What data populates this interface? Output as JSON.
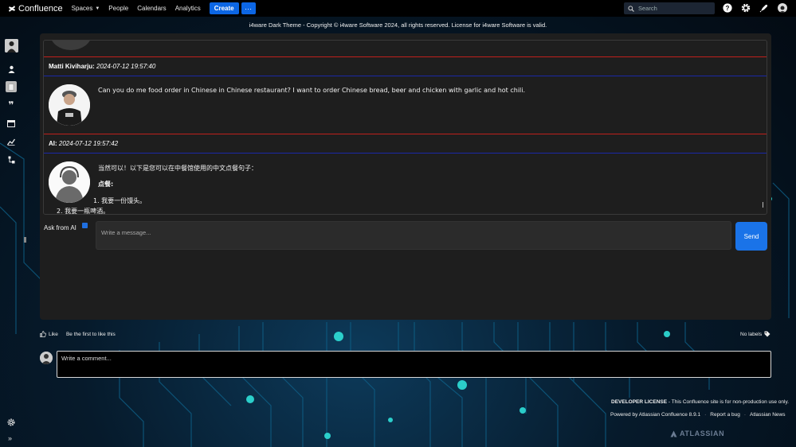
{
  "topbar": {
    "logo": "Confluence",
    "nav": [
      "Spaces",
      "People",
      "Calendars",
      "Analytics"
    ],
    "create_label": "Create",
    "more_label": "···",
    "search_placeholder": "Search"
  },
  "banner": "i4ware Dark Theme - Copyright © i4ware Software 2024, all rights reserved. License for i4ware Software is valid.",
  "chat": {
    "messages": [
      {
        "author": "Matti Kiviharju:",
        "timestamp": "2024-07-12 19:57:40",
        "text": "Can you do me food order in Chinese in Chinese restaurant? I want to order Chinese bread, beer and chicken with garlic and hot chili."
      },
      {
        "author": "AI:",
        "timestamp": "2024-07-12 19:57:42",
        "text": "当然可以！以下是您可以在中餐馆使用的中文点餐句子：",
        "heading": "点餐:",
        "items": [
          "1. 我要一份馒头。",
          "2. 我要一瓶啤酒。"
        ]
      }
    ]
  },
  "ask_ai_label": "Ask from AI",
  "message_placeholder": "Write a message...",
  "send_label": "Send",
  "like": {
    "label": "Like",
    "prompt": "Be the first to like this"
  },
  "labels_text": "No labels",
  "comment_placeholder": "Write a comment...",
  "footer": {
    "license_bold": "DEVELOPER LICENSE",
    "license_rest": " - This Confluence site is for non-production use only.",
    "links": [
      "Powered by Atlassian Confluence 8.9.1",
      "Report a bug",
      "Atlassian News"
    ],
    "brand": "ATLASSIAN"
  },
  "colors": {
    "accent": "#0c66e4",
    "send": "#1a73e8",
    "divider_red": "#c0201c",
    "divider_blue": "#1a28a8"
  }
}
